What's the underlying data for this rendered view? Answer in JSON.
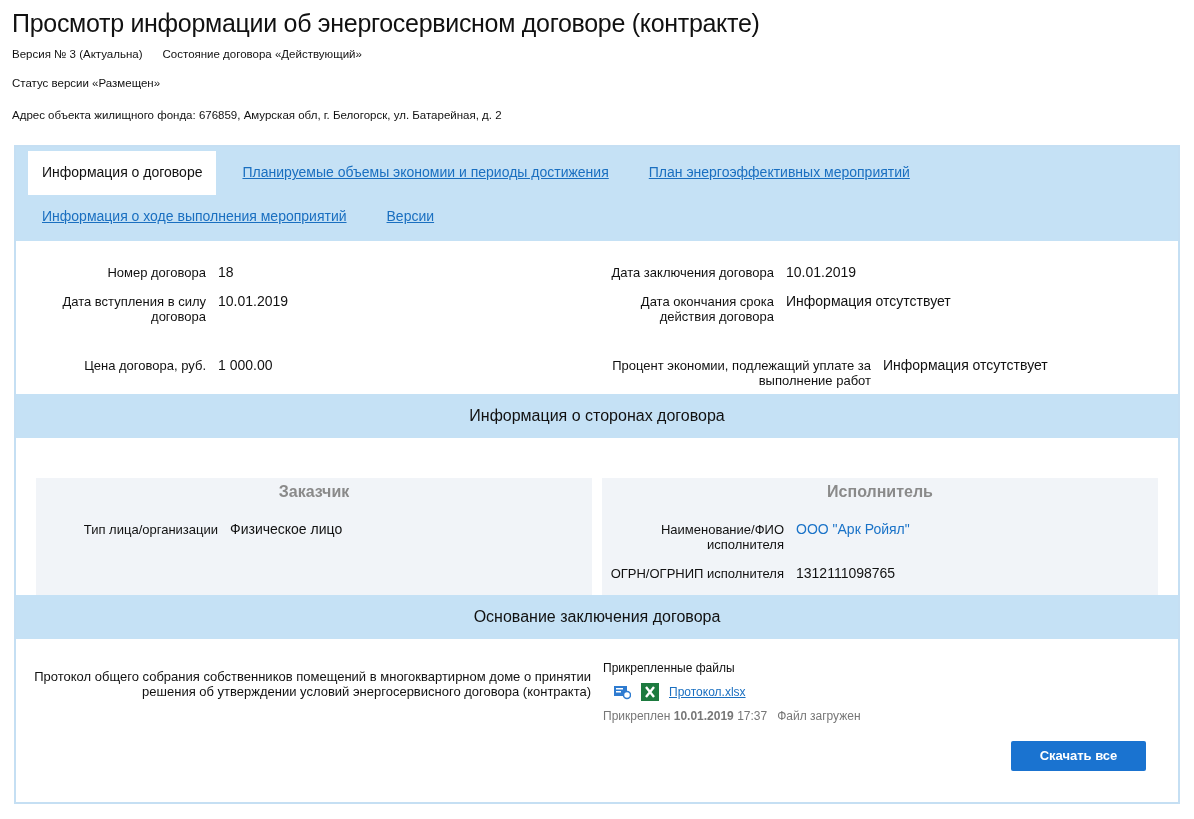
{
  "title": "Просмотр информации об энергосервисном договоре (контракте)",
  "meta": [
    {
      "label": "Версия № 3 (Актуальна)"
    },
    {
      "label": "Состояние договора «Действующий»"
    }
  ],
  "version_status": "Статус версии «Размещен»",
  "address": "Адрес объекта жилищного фонда: 676859, Амурская обл, г. Белогорск, ул. Батарейная, д. 2",
  "tabs": [
    {
      "label": "Информация о договоре",
      "selected": true
    },
    {
      "label": "Планируемые объемы экономии и периоды достижения",
      "selected": false
    },
    {
      "label": "План энергоэффективных мероприятий",
      "selected": false
    },
    {
      "label": "Информация о ходе выполнения мероприятий",
      "selected": false
    },
    {
      "label": "Версии",
      "selected": false
    }
  ],
  "fields": [
    {
      "label": "Номер договора",
      "value": "18"
    },
    {
      "label": "Дата заключения договора",
      "value": "10.01.2019"
    },
    {
      "label": "Дата вступления в силу договора",
      "value": "10.01.2019"
    },
    {
      "label": "Дата окончания срока действия договора",
      "value": "Информация отсутствует"
    },
    {
      "label": "Цена договора, руб.",
      "value": "1 000.00"
    },
    {
      "label": "Процент экономии, подлежащий уплате за выполнение работ",
      "value": "Информация отсутствует"
    }
  ],
  "parties": {
    "title": "Информация о сторонах договора",
    "cards": [
      {
        "title": "Заказчик",
        "fields": [
          {
            "label": "Тип лица/организации",
            "value": "Физическое лицо",
            "kind": "text"
          }
        ]
      },
      {
        "title": "Исполнитель",
        "fields": [
          {
            "label": "Наименование/ФИО исполнителя",
            "value": "ООО \"Арк Ройял\"",
            "kind": "link"
          },
          {
            "label": "ОГРН/ОГРНИП исполнителя",
            "value": "1312111098765",
            "kind": "text"
          }
        ]
      }
    ]
  },
  "basis": {
    "title": "Основание заключения договора",
    "label": "Протокол общего собрания собственников помещений в многоквартирном доме о принятии решения об утверждении условий энергосервисного договора (контракта)",
    "files_title": "Прикрепленные файлы",
    "file": {
      "name": "Протокол.xlsx",
      "attached": "Прикреплен **10.01.2019** 17:37",
      "status": "Файл загружен"
    },
    "download_button": "Скачать все"
  }
}
